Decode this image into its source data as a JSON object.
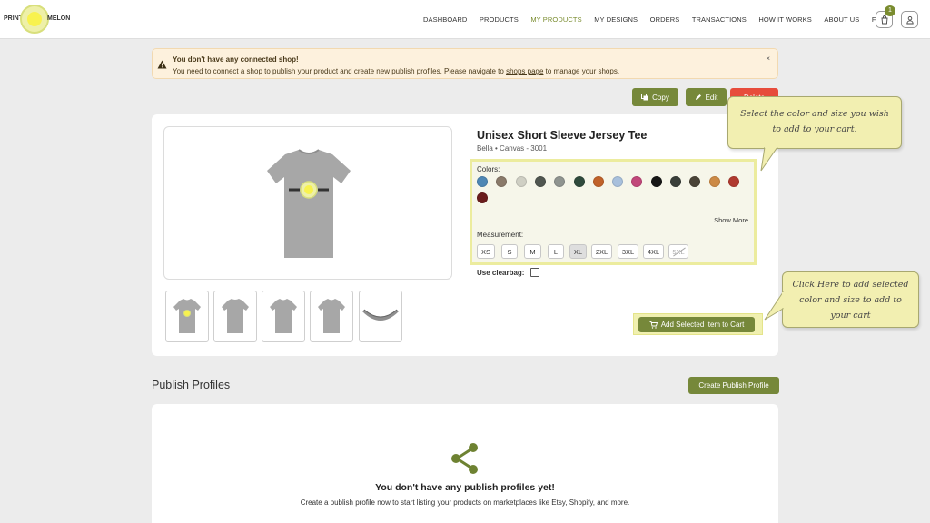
{
  "nav": {
    "logo_left": "PRINT",
    "logo_right": "MELON",
    "items": [
      "DASHBOARD",
      "PRODUCTS",
      "MY PRODUCTS",
      "MY DESIGNS",
      "ORDERS",
      "TRANSACTIONS",
      "HOW IT WORKS",
      "ABOUT US",
      "FAQ"
    ],
    "active_item": "MY PRODUCTS",
    "cart_count": "1",
    "accent_color": "#7a8c2f"
  },
  "alert": {
    "title": "You don't have any connected shop!",
    "message_before": "You need to connect a shop to publish your product and create new publish profiles. Please navigate to ",
    "link": "shops page",
    "message_after": " to manage your shops.",
    "close": "×"
  },
  "actions": {
    "copy": "Copy",
    "edit": "Edit",
    "delete": "Delete"
  },
  "product": {
    "title": "Unisex Short Sleeve Jersey Tee",
    "subtitle": "Bella • Canvas - 3001",
    "colors_label": "Colors:",
    "colors": [
      "#4e87b5",
      "#8a7a6a",
      "#cfcfc4",
      "#505650",
      "#8f9490",
      "#2f4a3c",
      "#c0622a",
      "#a8c0dc",
      "#c1477a",
      "#171717",
      "#3a3f3a",
      "#4a4438",
      "#cc8a46",
      "#b03a30",
      "#6a1c1c"
    ],
    "show_more": "Show More",
    "measurement_label": "Measurement:",
    "sizes": [
      "XS",
      "S",
      "M",
      "L",
      "XL",
      "2XL",
      "3XL",
      "4XL",
      "5XL"
    ],
    "selected_size": "XL",
    "unavailable_size": "5XL",
    "clearbag_label": "Use clearbag:",
    "add_to_cart": "Add Selected Item to Cart"
  },
  "tooltips": {
    "colors_line1": "Select the color and size you wish",
    "colors_line2": "to add to your cart.",
    "cart_line1": "Click Here to add selected",
    "cart_line2": "color and size to add to",
    "cart_line3": "your cart"
  },
  "publish": {
    "title": "Publish Profiles",
    "create_button": "Create Publish Profile",
    "empty_title": "You don't have any publish profiles yet!",
    "empty_desc": "Create a publish profile now to start listing your products on marketplaces like Etsy, Shopify, and more."
  }
}
